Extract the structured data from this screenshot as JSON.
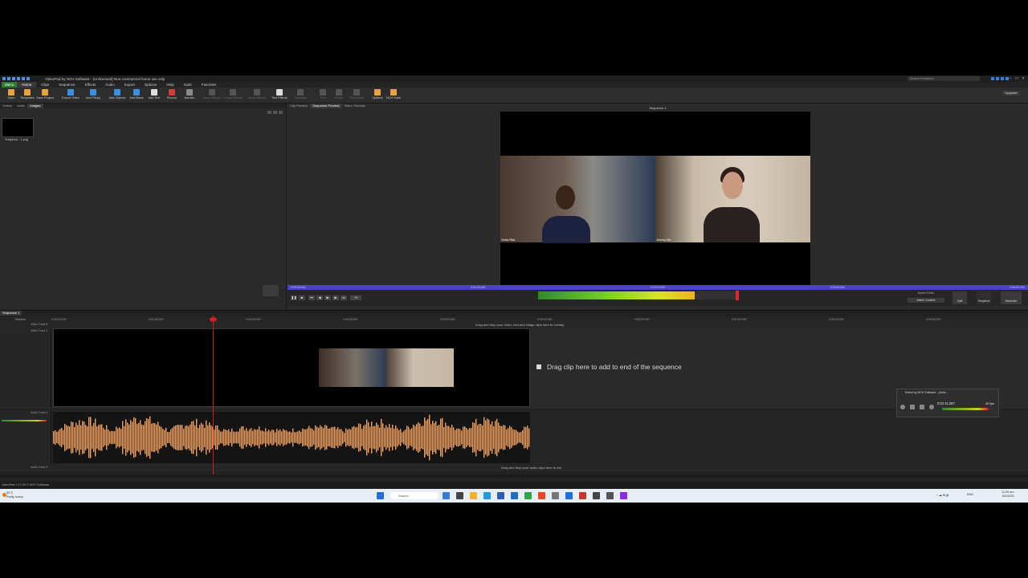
{
  "window": {
    "title": "VideoPad by NCH Software - (Unlicensed) Non-commercial home use only",
    "search_placeholder": "Search Features",
    "upgrade_label": "Upgrade"
  },
  "menu": [
    "Menu",
    "Home",
    "Clips",
    "Sequence",
    "Effects",
    "Audio",
    "Export",
    "Options",
    "Help",
    "Suite",
    "Favorites"
  ],
  "ribbon": [
    {
      "label": "Open",
      "color": "#e6a23c"
    },
    {
      "label": "Templates",
      "color": "#e6a23c"
    },
    {
      "label": "Save Project",
      "color": "#e6a23c"
    },
    {
      "label": "Export Video",
      "color": "#3b8fe0"
    },
    {
      "label": "Add File(s)",
      "color": "#3b8fe0"
    },
    {
      "label": "Add Objects",
      "color": "#3b8fe0"
    },
    {
      "label": "Add Blank",
      "color": "#3b8fe0"
    },
    {
      "label": "Add Text",
      "color": "#dddddd"
    },
    {
      "label": "Record",
      "color": "#d83a3a"
    },
    {
      "label": "Narrate",
      "color": "#888888"
    },
    {
      "label": "Video Effects",
      "color": "#555555"
    },
    {
      "label": "Image Effects",
      "color": "#555555"
    },
    {
      "label": "Audio Effects",
      "color": "#555555"
    },
    {
      "label": "Text Effects",
      "color": "#dddddd"
    },
    {
      "label": "Transition",
      "color": "#555555"
    },
    {
      "label": "Trim",
      "color": "#555555"
    },
    {
      "label": "Delete",
      "color": "#555555"
    },
    {
      "label": "Storyboard",
      "color": "#555555"
    },
    {
      "label": "Options",
      "color": "#e6a23c"
    },
    {
      "label": "NCH Suite",
      "color": "#e6a23c"
    }
  ],
  "media_panel": {
    "tabs": [
      "Videos",
      "Audio",
      "Images"
    ],
    "active_tab": "Images",
    "item_label": "Snapshot - 1.png"
  },
  "preview": {
    "tabs": [
      "Clip Preview",
      "Sequence Preview",
      "Video Tutorials"
    ],
    "sequence_title": "Sequence 1",
    "participant_left": "Vinita Pillai",
    "participant_right": "Jeremy Kim",
    "scrub_ticks": [
      "0:00:00.000",
      "0:01:00.000",
      "0:02:00.000",
      "0:03:00.000",
      "0:04:00.000"
    ],
    "aspect_ratio_label": "Aspect Ratio:",
    "aspect_ratio_value": "Match Content",
    "split_label": "Split",
    "snapshot_label": "Snapshot",
    "maximize_label": "Maximize"
  },
  "timeline": {
    "tab": "Sequence 1",
    "ruler_label": "Timeline",
    "ticks": [
      "0:00:00.000",
      "0:01:00.000",
      "0:02:00.000",
      "0:03:00.000",
      "0:04:00.000",
      "0:05:00.000",
      "0:06:00.000",
      "0:07:00.000",
      "0:08:00.000",
      "0:09:00.000"
    ],
    "overlay_hint": "Drag and drop your video, text and image clips here to overlay",
    "video_track_name": "Video Track 5",
    "video_track_1": "Video Track 1",
    "drag_clip_hint": "Drag clip here to add to end of the sequence",
    "audio_track_name": "Audio Track 1",
    "audio_track_2": "Audio Track 2",
    "audio_mix_hint": "Drag and drop your audio clips here to mix"
  },
  "recorder": {
    "title": "Debut by NCH Software - (Unlic...",
    "time": "0:01:11.267",
    "fps": "30 fps"
  },
  "status": {
    "text": "VideoPad v 17.00 © NCH Software"
  },
  "taskbar": {
    "temperature": "30°C",
    "weather": "Partly sunny",
    "search_label": "Search",
    "lang": "ENG",
    "region": "US",
    "time": "11:29 am",
    "date": "8/2/2025"
  }
}
